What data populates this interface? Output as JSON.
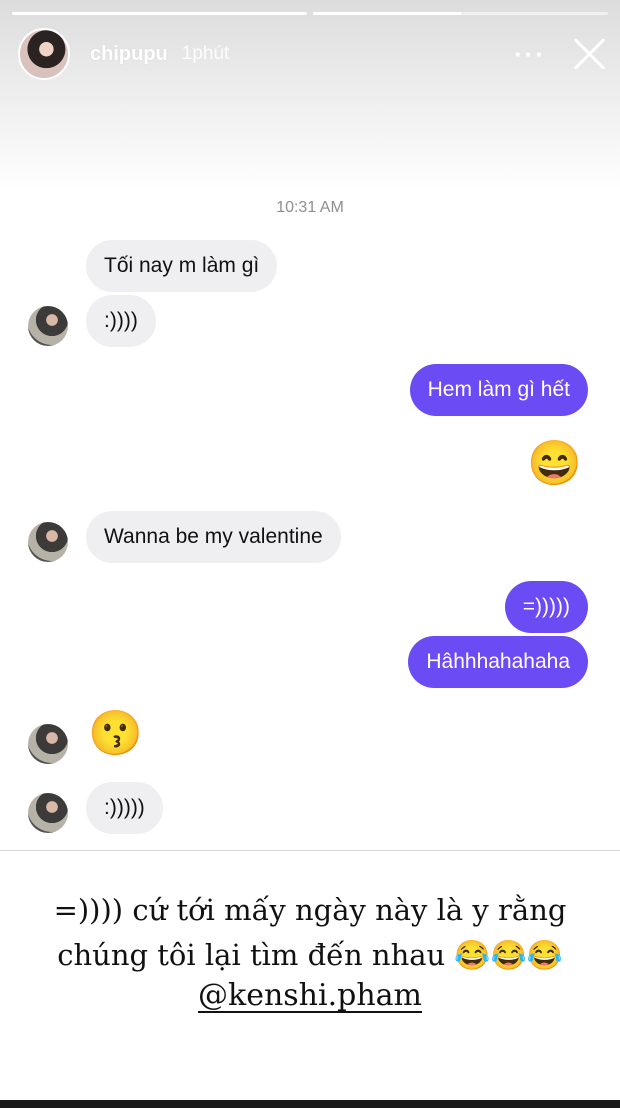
{
  "story": {
    "username": "chipupu",
    "posted_ago": "1phút",
    "more_label": "···",
    "progress": [
      1.0,
      0.5
    ]
  },
  "chat": {
    "timestamp": "10:31 AM",
    "messages": [
      {
        "from": "them",
        "text": "Tối nay m làm gì"
      },
      {
        "from": "them",
        "text": ":))))"
      },
      {
        "from": "me",
        "text": "Hem làm gì hết"
      },
      {
        "from": "me",
        "emoji": "😄"
      },
      {
        "from": "them",
        "text": "Wanna be my valentine"
      },
      {
        "from": "me",
        "text": "=)))))"
      },
      {
        "from": "me",
        "text": "Hâhhhahahaha"
      },
      {
        "from": "them",
        "emoji": "😗"
      },
      {
        "from": "them",
        "text": ":)))))"
      }
    ]
  },
  "caption": {
    "line1": "=)))) cứ tới mấy ngày này là y rằng",
    "line2": "chúng tôi lại tìm đến nhau 😂😂😂",
    "mention": "@kenshi.pham"
  }
}
